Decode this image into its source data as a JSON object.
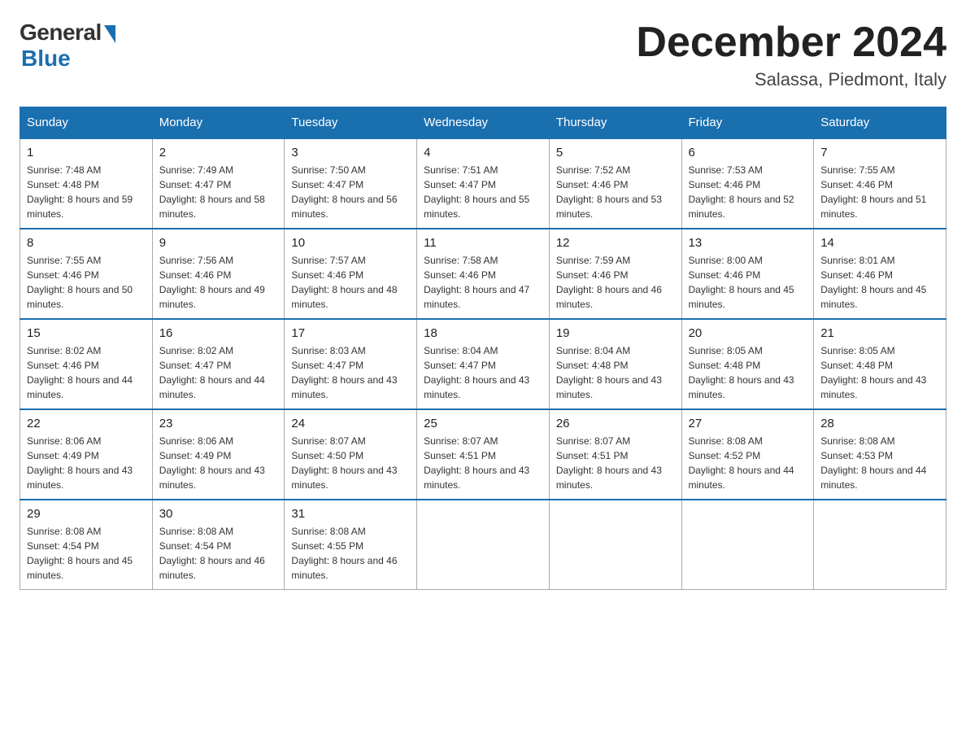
{
  "logo": {
    "general": "General",
    "blue": "Blue"
  },
  "title": "December 2024",
  "location": "Salassa, Piedmont, Italy",
  "days_of_week": [
    "Sunday",
    "Monday",
    "Tuesday",
    "Wednesday",
    "Thursday",
    "Friday",
    "Saturday"
  ],
  "weeks": [
    [
      {
        "day": "1",
        "sunrise": "7:48 AM",
        "sunset": "4:48 PM",
        "daylight": "8 hours and 59 minutes."
      },
      {
        "day": "2",
        "sunrise": "7:49 AM",
        "sunset": "4:47 PM",
        "daylight": "8 hours and 58 minutes."
      },
      {
        "day": "3",
        "sunrise": "7:50 AM",
        "sunset": "4:47 PM",
        "daylight": "8 hours and 56 minutes."
      },
      {
        "day": "4",
        "sunrise": "7:51 AM",
        "sunset": "4:47 PM",
        "daylight": "8 hours and 55 minutes."
      },
      {
        "day": "5",
        "sunrise": "7:52 AM",
        "sunset": "4:46 PM",
        "daylight": "8 hours and 53 minutes."
      },
      {
        "day": "6",
        "sunrise": "7:53 AM",
        "sunset": "4:46 PM",
        "daylight": "8 hours and 52 minutes."
      },
      {
        "day": "7",
        "sunrise": "7:55 AM",
        "sunset": "4:46 PM",
        "daylight": "8 hours and 51 minutes."
      }
    ],
    [
      {
        "day": "8",
        "sunrise": "7:55 AM",
        "sunset": "4:46 PM",
        "daylight": "8 hours and 50 minutes."
      },
      {
        "day": "9",
        "sunrise": "7:56 AM",
        "sunset": "4:46 PM",
        "daylight": "8 hours and 49 minutes."
      },
      {
        "day": "10",
        "sunrise": "7:57 AM",
        "sunset": "4:46 PM",
        "daylight": "8 hours and 48 minutes."
      },
      {
        "day": "11",
        "sunrise": "7:58 AM",
        "sunset": "4:46 PM",
        "daylight": "8 hours and 47 minutes."
      },
      {
        "day": "12",
        "sunrise": "7:59 AM",
        "sunset": "4:46 PM",
        "daylight": "8 hours and 46 minutes."
      },
      {
        "day": "13",
        "sunrise": "8:00 AM",
        "sunset": "4:46 PM",
        "daylight": "8 hours and 45 minutes."
      },
      {
        "day": "14",
        "sunrise": "8:01 AM",
        "sunset": "4:46 PM",
        "daylight": "8 hours and 45 minutes."
      }
    ],
    [
      {
        "day": "15",
        "sunrise": "8:02 AM",
        "sunset": "4:46 PM",
        "daylight": "8 hours and 44 minutes."
      },
      {
        "day": "16",
        "sunrise": "8:02 AM",
        "sunset": "4:47 PM",
        "daylight": "8 hours and 44 minutes."
      },
      {
        "day": "17",
        "sunrise": "8:03 AM",
        "sunset": "4:47 PM",
        "daylight": "8 hours and 43 minutes."
      },
      {
        "day": "18",
        "sunrise": "8:04 AM",
        "sunset": "4:47 PM",
        "daylight": "8 hours and 43 minutes."
      },
      {
        "day": "19",
        "sunrise": "8:04 AM",
        "sunset": "4:48 PM",
        "daylight": "8 hours and 43 minutes."
      },
      {
        "day": "20",
        "sunrise": "8:05 AM",
        "sunset": "4:48 PM",
        "daylight": "8 hours and 43 minutes."
      },
      {
        "day": "21",
        "sunrise": "8:05 AM",
        "sunset": "4:48 PM",
        "daylight": "8 hours and 43 minutes."
      }
    ],
    [
      {
        "day": "22",
        "sunrise": "8:06 AM",
        "sunset": "4:49 PM",
        "daylight": "8 hours and 43 minutes."
      },
      {
        "day": "23",
        "sunrise": "8:06 AM",
        "sunset": "4:49 PM",
        "daylight": "8 hours and 43 minutes."
      },
      {
        "day": "24",
        "sunrise": "8:07 AM",
        "sunset": "4:50 PM",
        "daylight": "8 hours and 43 minutes."
      },
      {
        "day": "25",
        "sunrise": "8:07 AM",
        "sunset": "4:51 PM",
        "daylight": "8 hours and 43 minutes."
      },
      {
        "day": "26",
        "sunrise": "8:07 AM",
        "sunset": "4:51 PM",
        "daylight": "8 hours and 43 minutes."
      },
      {
        "day": "27",
        "sunrise": "8:08 AM",
        "sunset": "4:52 PM",
        "daylight": "8 hours and 44 minutes."
      },
      {
        "day": "28",
        "sunrise": "8:08 AM",
        "sunset": "4:53 PM",
        "daylight": "8 hours and 44 minutes."
      }
    ],
    [
      {
        "day": "29",
        "sunrise": "8:08 AM",
        "sunset": "4:54 PM",
        "daylight": "8 hours and 45 minutes."
      },
      {
        "day": "30",
        "sunrise": "8:08 AM",
        "sunset": "4:54 PM",
        "daylight": "8 hours and 46 minutes."
      },
      {
        "day": "31",
        "sunrise": "8:08 AM",
        "sunset": "4:55 PM",
        "daylight": "8 hours and 46 minutes."
      },
      null,
      null,
      null,
      null
    ]
  ]
}
